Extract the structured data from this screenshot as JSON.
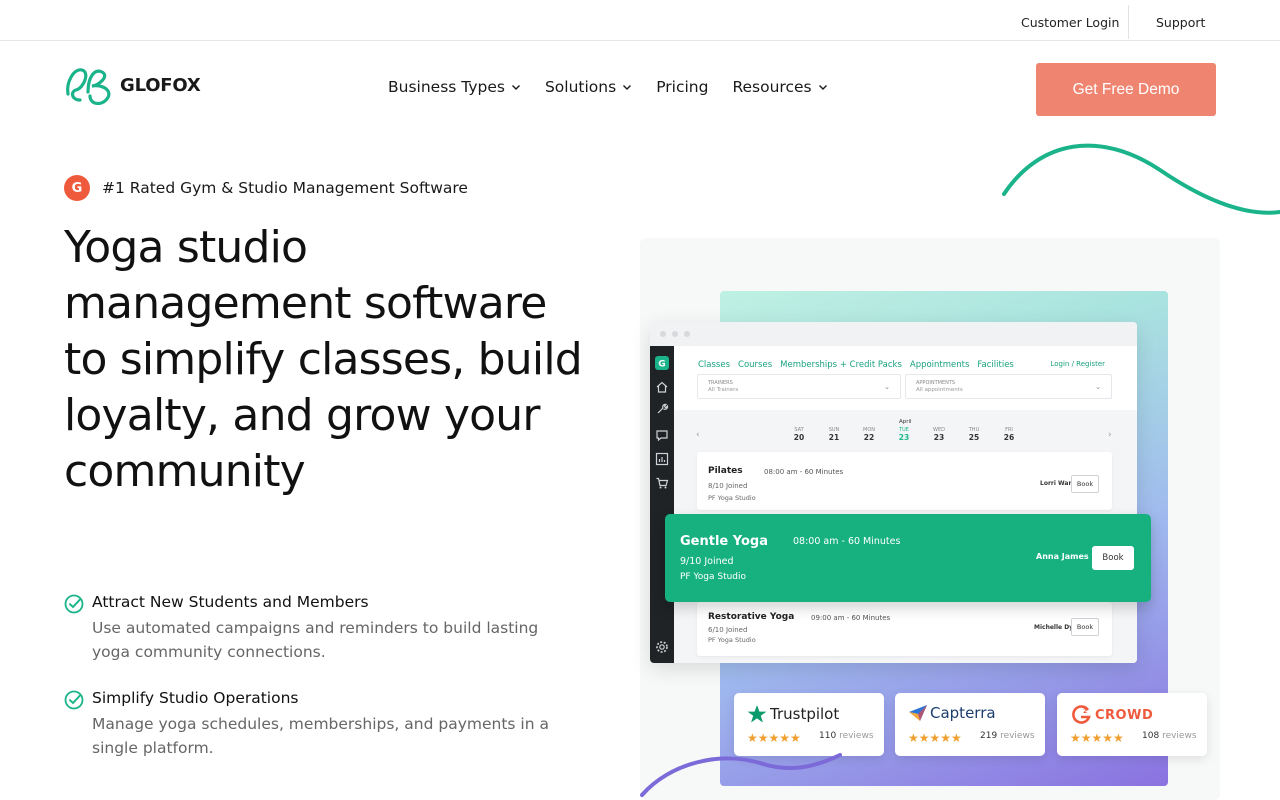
{
  "utility": {
    "customer_login": "Customer Login",
    "support": "Support"
  },
  "brand": {
    "name": "GLOFOX",
    "accent": "#1ab38a",
    "cta_color": "#ef8571"
  },
  "nav": {
    "items": [
      {
        "label": "Business Types",
        "has_dropdown": true
      },
      {
        "label": "Solutions",
        "has_dropdown": true
      },
      {
        "label": "Pricing",
        "has_dropdown": false
      },
      {
        "label": "Resources",
        "has_dropdown": true
      }
    ],
    "cta": "Get Free Demo"
  },
  "hero": {
    "badge": "#1 Rated Gym & Studio Management Software",
    "badge_logo": "G",
    "title": "Yoga studio management software to simplify classes, build loyalty, and grow your community",
    "features": [
      {
        "title": "Attract New Students and Members",
        "desc": "Use automated campaigns and reminders to build lasting yoga community connections."
      },
      {
        "title": "Simplify Studio Operations",
        "desc": "Manage yoga schedules, memberships, and payments in a single platform."
      }
    ]
  },
  "app": {
    "tabs": [
      "Classes",
      "Courses",
      "Memberships + Credit Packs",
      "Appointments",
      "Facilities"
    ],
    "login": "Login / Register",
    "filters": [
      {
        "label": "TRAINERS",
        "value": "All Trainers"
      },
      {
        "label": "APPOINTMENTS",
        "value": "All appointments"
      }
    ],
    "month": "April",
    "days": [
      {
        "name": "SAT",
        "date": "20"
      },
      {
        "name": "SUN",
        "date": "21"
      },
      {
        "name": "MON",
        "date": "22"
      },
      {
        "name": "TUE",
        "date": "23"
      },
      {
        "name": "WED",
        "date": "23"
      },
      {
        "name": "THU",
        "date": "25"
      },
      {
        "name": "FRI",
        "date": "26"
      }
    ],
    "selected_day_index": 3,
    "classes": [
      {
        "name": "Pilates",
        "time": "08:00 am - 60 Minutes",
        "joined": "8/10 Joined",
        "studio": "PF Yoga Studio",
        "trainer": "Lorri Warf",
        "book": "Book"
      },
      {
        "name": "Gentle Yoga",
        "time": "08:00 am - 60 Minutes",
        "joined": "9/10 Joined",
        "studio": "PF Yoga Studio",
        "trainer": "Anna James",
        "book": "Book"
      },
      {
        "name": "Restorative Yoga",
        "time": "09:00 am - 60 Minutes",
        "joined": "6/10 Joined",
        "studio": "PF Yoga Studio",
        "trainer": "Michelle Dy",
        "book": "Book"
      }
    ]
  },
  "reviews": [
    {
      "brand": "Trustpilot",
      "rating": 4.5,
      "stars": "★★★★★",
      "count": "110",
      "label": "reviews"
    },
    {
      "brand": "Capterra",
      "rating": 4.5,
      "stars": "★★★★★",
      "count": "219",
      "label": "reviews"
    },
    {
      "brand": "CROWD",
      "rating": 5,
      "stars": "★★★★★",
      "count": "108",
      "label": "reviews"
    }
  ]
}
